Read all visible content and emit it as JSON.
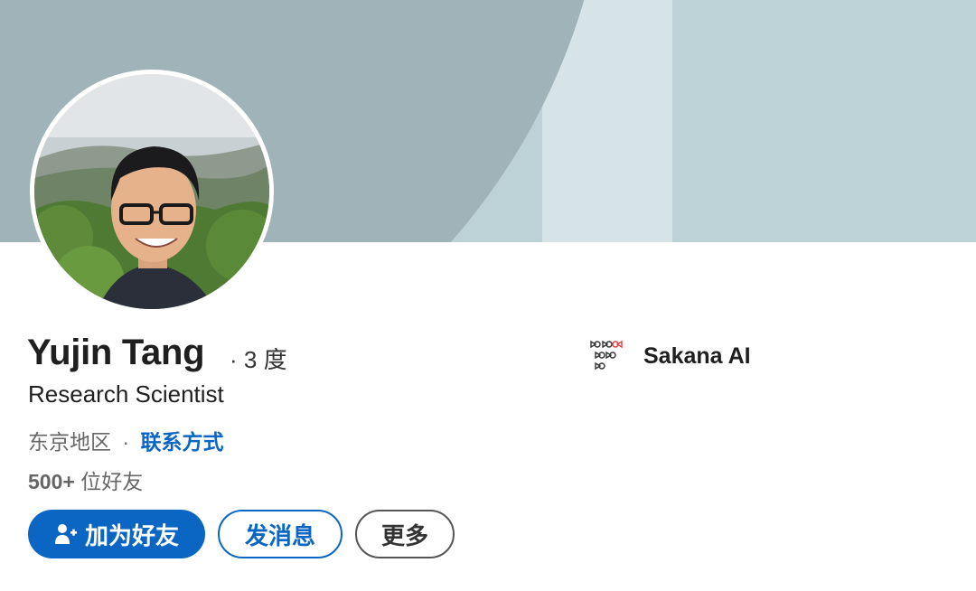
{
  "profile": {
    "name": "Yujin Tang",
    "degree": "· 3 度",
    "headline": "Research Scientist",
    "location": "东京地区",
    "location_separator": "·",
    "contact_link": "联系方式",
    "connections_count": "500+",
    "connections_label": "位好友"
  },
  "actions": {
    "connect_label": "加为好友",
    "message_label": "发消息",
    "more_label": "更多"
  },
  "company": {
    "name": "Sakana AI",
    "logo_icon": "sakana-fish-school-icon"
  },
  "colors": {
    "accent": "#0a66c2",
    "banner_dark": "#9fb3b8",
    "banner_light": "#bdd2d6",
    "banner_mid": "#d6e4e8",
    "logo_red": "#e5413b"
  }
}
